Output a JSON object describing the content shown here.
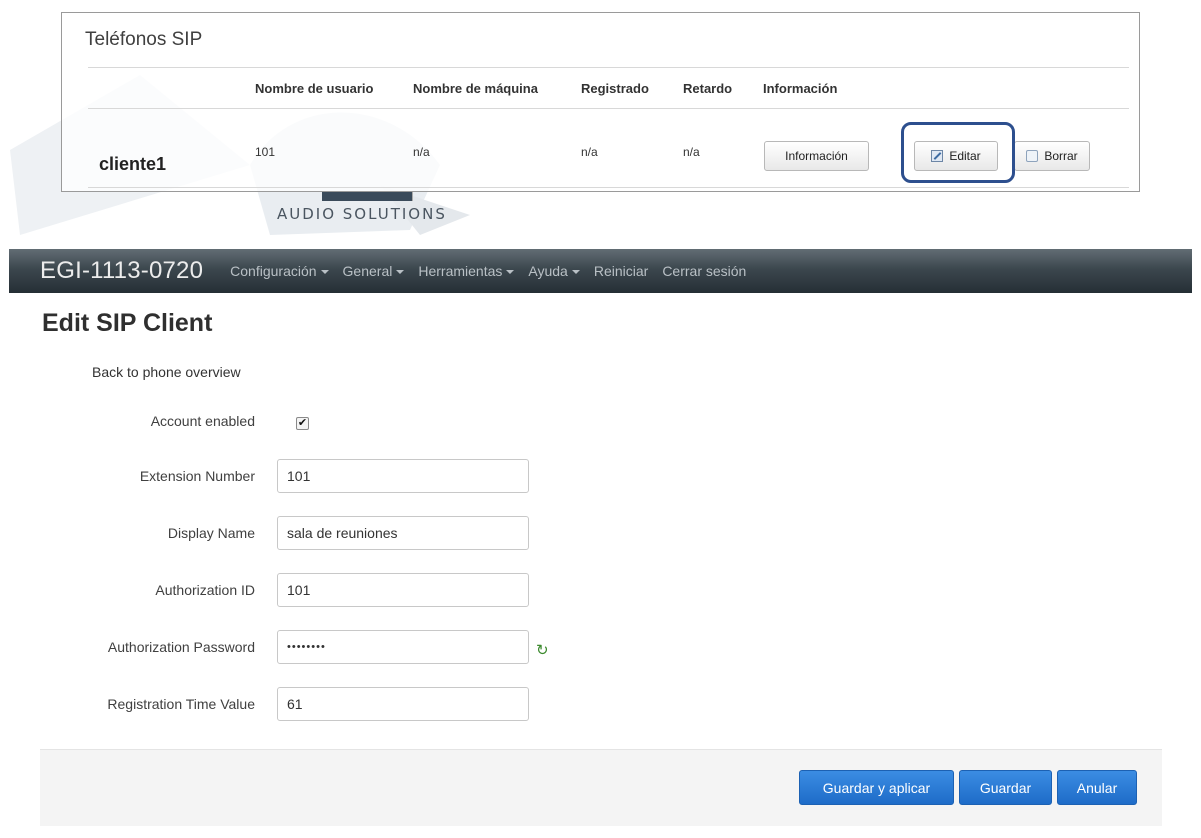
{
  "logo": {
    "text": "AUDIO SOLUTIONS"
  },
  "sip_phones": {
    "title": "Teléfonos SIP",
    "columns": [
      "Nombre de usuario",
      "Nombre de máquina",
      "Registrado",
      "Retardo",
      "Información"
    ],
    "rows": [
      {
        "name": "cliente1",
        "username": "101",
        "hostname": "n/a",
        "registered": "n/a",
        "delay": "n/a",
        "info_button": "Información",
        "edit_button": "Editar",
        "delete_button": "Borrar"
      }
    ]
  },
  "navbar": {
    "brand": "EGI-1113-0720",
    "items": [
      {
        "label": "Configuración",
        "dropdown": true
      },
      {
        "label": "General",
        "dropdown": true
      },
      {
        "label": "Herramientas",
        "dropdown": true
      },
      {
        "label": "Ayuda",
        "dropdown": true
      },
      {
        "label": "Reiniciar",
        "dropdown": false
      },
      {
        "label": "Cerrar sesión",
        "dropdown": false
      }
    ]
  },
  "page": {
    "title": "Edit SIP Client",
    "back_link": "Back to phone overview"
  },
  "form": {
    "account_enabled": {
      "label": "Account enabled",
      "checked": true,
      "check_glyph": "✔"
    },
    "extension_number": {
      "label": "Extension Number",
      "value": "101"
    },
    "display_name": {
      "label": "Display Name",
      "value": "sala de reuniones"
    },
    "authorization_id": {
      "label": "Authorization ID",
      "value": "101"
    },
    "authorization_password": {
      "label": "Authorization Password",
      "value": "••••••••",
      "reveal_icon": "refresh-reveal-icon"
    },
    "registration_time": {
      "label": "Registration Time Value",
      "value": "61"
    }
  },
  "actions": {
    "save_apply": "Guardar y aplicar",
    "save": "Guardar",
    "cancel": "Anular"
  },
  "colors": {
    "primary_button": "#1e6cc8",
    "navbar": "#3c474e",
    "highlight": "#2d4f8e"
  }
}
